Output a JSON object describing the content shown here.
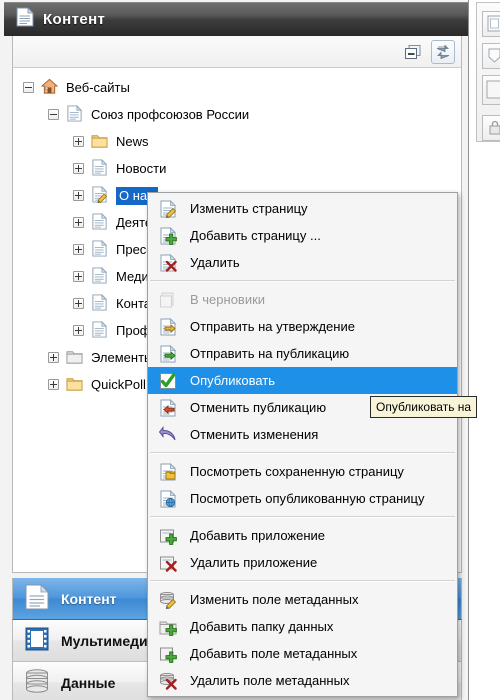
{
  "panel": {
    "title": "Контент",
    "header_icon": "document-icon"
  },
  "toolbar": {
    "collapse_all_label": "collapse-all",
    "sync_label": "sync-tree"
  },
  "tree": {
    "items": [
      {
        "label": "Веб-сайты",
        "icon": "home-icon",
        "expander": "minus",
        "indent": 0,
        "selected": false
      },
      {
        "label": "Союз профсоюзов России",
        "icon": "page-icon",
        "expander": "minus",
        "indent": 1,
        "selected": false
      },
      {
        "label": "News",
        "icon": "folder-yellow-icon",
        "expander": "plus",
        "indent": 2,
        "selected": false
      },
      {
        "label": "Новости",
        "icon": "page-icon",
        "expander": "plus",
        "indent": 2,
        "selected": false
      },
      {
        "label": "О нас",
        "icon": "page-edit-icon",
        "expander": "plus",
        "indent": 2,
        "selected": true
      },
      {
        "label": "Деятельность",
        "icon": "page-icon",
        "expander": "plus",
        "indent": 2,
        "selected": false
      },
      {
        "label": "Пресс-центр",
        "icon": "page-icon",
        "expander": "plus",
        "indent": 2,
        "selected": false
      },
      {
        "label": "Медиа",
        "icon": "page-icon",
        "expander": "plus",
        "indent": 2,
        "selected": false
      },
      {
        "label": "Контакты",
        "icon": "page-icon",
        "expander": "plus",
        "indent": 2,
        "selected": false
      },
      {
        "label": "Профсоюзы",
        "icon": "page-icon",
        "expander": "plus",
        "indent": 2,
        "selected": false
      },
      {
        "label": "Элементы веб-сайта",
        "icon": "folder-gray-icon",
        "expander": "plus",
        "indent": 1,
        "selected": false
      },
      {
        "label": "QuickPoll",
        "icon": "folder-yellow-icon",
        "expander": "plus",
        "indent": 1,
        "selected": false
      }
    ]
  },
  "accordion": {
    "items": [
      {
        "label": "Контент",
        "icon": "document-icon",
        "active": true
      },
      {
        "label": "Мультимедиа",
        "icon": "film-icon",
        "active": false
      },
      {
        "label": "Данные",
        "icon": "database-icon",
        "active": false
      }
    ]
  },
  "context_menu": {
    "groups": [
      {
        "items": [
          {
            "label": "Изменить страницу",
            "icon": "page-edit-icon",
            "state": "normal"
          },
          {
            "label": "Добавить страницу ...",
            "icon": "page-add-icon",
            "state": "normal"
          },
          {
            "label": "Удалить",
            "icon": "page-delete-icon",
            "state": "normal"
          }
        ]
      },
      {
        "items": [
          {
            "label": "В черновики",
            "icon": "draft-icon",
            "state": "disabled"
          },
          {
            "label": "Отправить на утверждение",
            "icon": "send-approve-icon",
            "state": "normal"
          },
          {
            "label": "Отправить на публикацию",
            "icon": "send-publish-icon",
            "state": "normal"
          },
          {
            "label": "Опубликовать",
            "icon": "publish-check-icon",
            "state": "highlight"
          },
          {
            "label": "Отменить публикацию",
            "icon": "unpublish-icon",
            "state": "normal"
          },
          {
            "label": "Отменить изменения",
            "icon": "undo-arrow-icon",
            "state": "normal"
          }
        ]
      },
      {
        "items": [
          {
            "label": "Посмотреть сохраненную страницу",
            "icon": "view-saved-icon",
            "state": "normal"
          },
          {
            "label": "Посмотреть опубликованную страницу",
            "icon": "view-published-icon",
            "state": "normal"
          }
        ]
      },
      {
        "items": [
          {
            "label": "Добавить приложение",
            "icon": "app-add-icon",
            "state": "normal"
          },
          {
            "label": "Удалить приложение",
            "icon": "app-delete-icon",
            "state": "normal"
          }
        ]
      },
      {
        "items": [
          {
            "label": "Изменить поле метаданных",
            "icon": "meta-edit-icon",
            "state": "normal"
          },
          {
            "label": "Добавить папку данных",
            "icon": "data-folder-add-icon",
            "state": "normal"
          },
          {
            "label": "Добавить поле метаданных",
            "icon": "meta-add-icon",
            "state": "normal"
          },
          {
            "label": "Удалить поле метаданных",
            "icon": "meta-delete-icon",
            "state": "normal"
          }
        ]
      }
    ]
  },
  "tooltip": {
    "text": "Опубликовать на"
  },
  "colors": {
    "selection_blue": "#1568c6",
    "menu_highlight": "#1e90e8",
    "accordion_active": "#4e96db",
    "tooltip_bg": "#f7f4d8",
    "header_dark": "#3c3c3c"
  }
}
